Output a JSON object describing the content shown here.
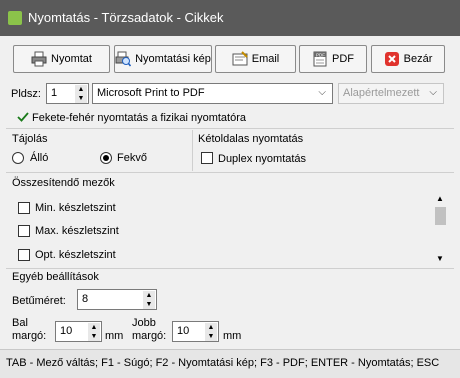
{
  "window": {
    "title": "Nyomtatás - Törzsadatok - Cikkek"
  },
  "toolbar": {
    "print_label": "Nyomtat",
    "preview_label": "Nyomtatási kép",
    "email_label": "Email",
    "pdf_label": "PDF",
    "close_label": "Bezár"
  },
  "copies": {
    "label": "Pldsz:",
    "value": "1"
  },
  "printer": {
    "value": "Microsoft Print to PDF"
  },
  "paper": {
    "value": "Alapértelmezett"
  },
  "bw_print": {
    "label": "Fekete-fehér nyomtatás a fizikai nyomtatóra",
    "checked": true
  },
  "orientation": {
    "title": "Tájolás",
    "portrait_label": "Álló",
    "landscape_label": "Fekvő",
    "selected": "Fekvő"
  },
  "duplex": {
    "title": "Kétoldalas nyomtatás",
    "label": "Duplex nyomtatás",
    "checked": false
  },
  "sum_fields": {
    "title": "Összesítendő mezők",
    "items": [
      {
        "label": "Min. készletszint",
        "checked": false
      },
      {
        "label": "Max. készletszint",
        "checked": false
      },
      {
        "label": "Opt. készletszint",
        "checked": false
      }
    ]
  },
  "other": {
    "title": "Egyéb beállítások",
    "font_size_label": "Betűméret:",
    "font_size_value": "8",
    "left_margin_label_1": "Bal",
    "left_margin_label_2": "margó:",
    "left_margin_value": "10",
    "right_margin_label_1": "Jobb",
    "right_margin_label_2": "margó:",
    "right_margin_value": "10",
    "unit": "mm"
  },
  "status": {
    "text": "TAB - Mező váltás; F1 - Súgó; F2 - Nyomtatási kép; F3 - PDF; ENTER - Nyomtatás; ESC"
  },
  "icons": [
    "app-icon",
    "printer-icon",
    "preview-icon",
    "email-icon",
    "pdf-icon",
    "close-x-icon",
    "chevron-down-icon",
    "check-icon",
    "scroll-up-icon",
    "scroll-down-icon"
  ]
}
